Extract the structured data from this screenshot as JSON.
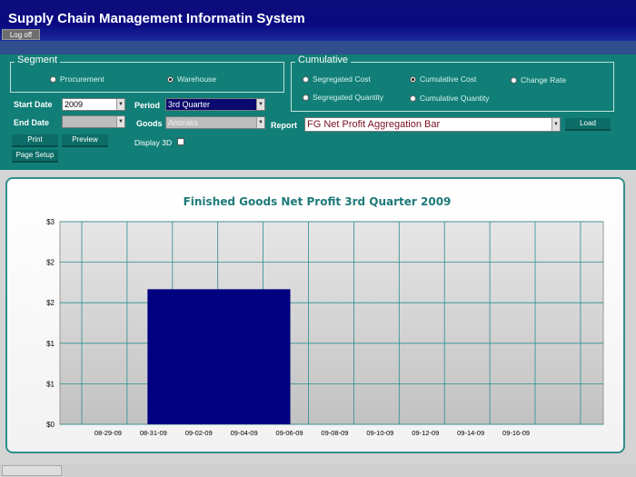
{
  "app": {
    "title": "Supply Chain Management Informatin System",
    "logoff_label": "Log off"
  },
  "segment": {
    "legend": "Segment",
    "options": [
      {
        "label": "Procurement",
        "selected": false
      },
      {
        "label": "Warehouse",
        "selected": true
      }
    ]
  },
  "cumulative": {
    "legend": "Cumulative",
    "options": [
      {
        "label": "Segregated Cost",
        "selected": false
      },
      {
        "label": "Cumulative Cost",
        "selected": true
      },
      {
        "label": "Change Rate",
        "selected": false
      },
      {
        "label": "Segregated Quantity",
        "selected": false
      },
      {
        "label": "Cumulative Quantity",
        "selected": false
      }
    ]
  },
  "filters": {
    "start_date_label": "Start Date",
    "start_date_value": "2009",
    "end_date_label": "End Date",
    "end_date_value": "",
    "period_label": "Period",
    "period_value": "3rd Quarter",
    "goods_label": "Goods",
    "goods_value": "Anoraks",
    "report_label": "Report",
    "report_value": "FG Net Profit Aggregation Bar",
    "display3d_label": "Display 3D",
    "display3d_checked": false
  },
  "buttons": {
    "print": "Print",
    "preview": "Preview",
    "page_setup": "Page Setup",
    "load": "Load"
  },
  "colors": {
    "panel": "#117f77",
    "bar": "#000080",
    "title_bar": "#0a0a82"
  },
  "chart_data": {
    "type": "bar",
    "title": "Finished Goods Net Profit 3rd Quarter 2009",
    "x_ticks": [
      "08-29-09",
      "08-31-09",
      "09-02-09",
      "09-04-09",
      "09-06-09",
      "09-08-09",
      "09-10-09",
      "09-12-09",
      "09-14-09",
      "09-16-09"
    ],
    "y_ticks": [
      "$3",
      "$2",
      "$2",
      "$1",
      "$1",
      "$0"
    ],
    "y_range": [
      0,
      3
    ],
    "bars": [
      {
        "x_from": "08-31-09",
        "x_to": "09-06-09",
        "value": 2.0
      }
    ],
    "grid": true
  }
}
